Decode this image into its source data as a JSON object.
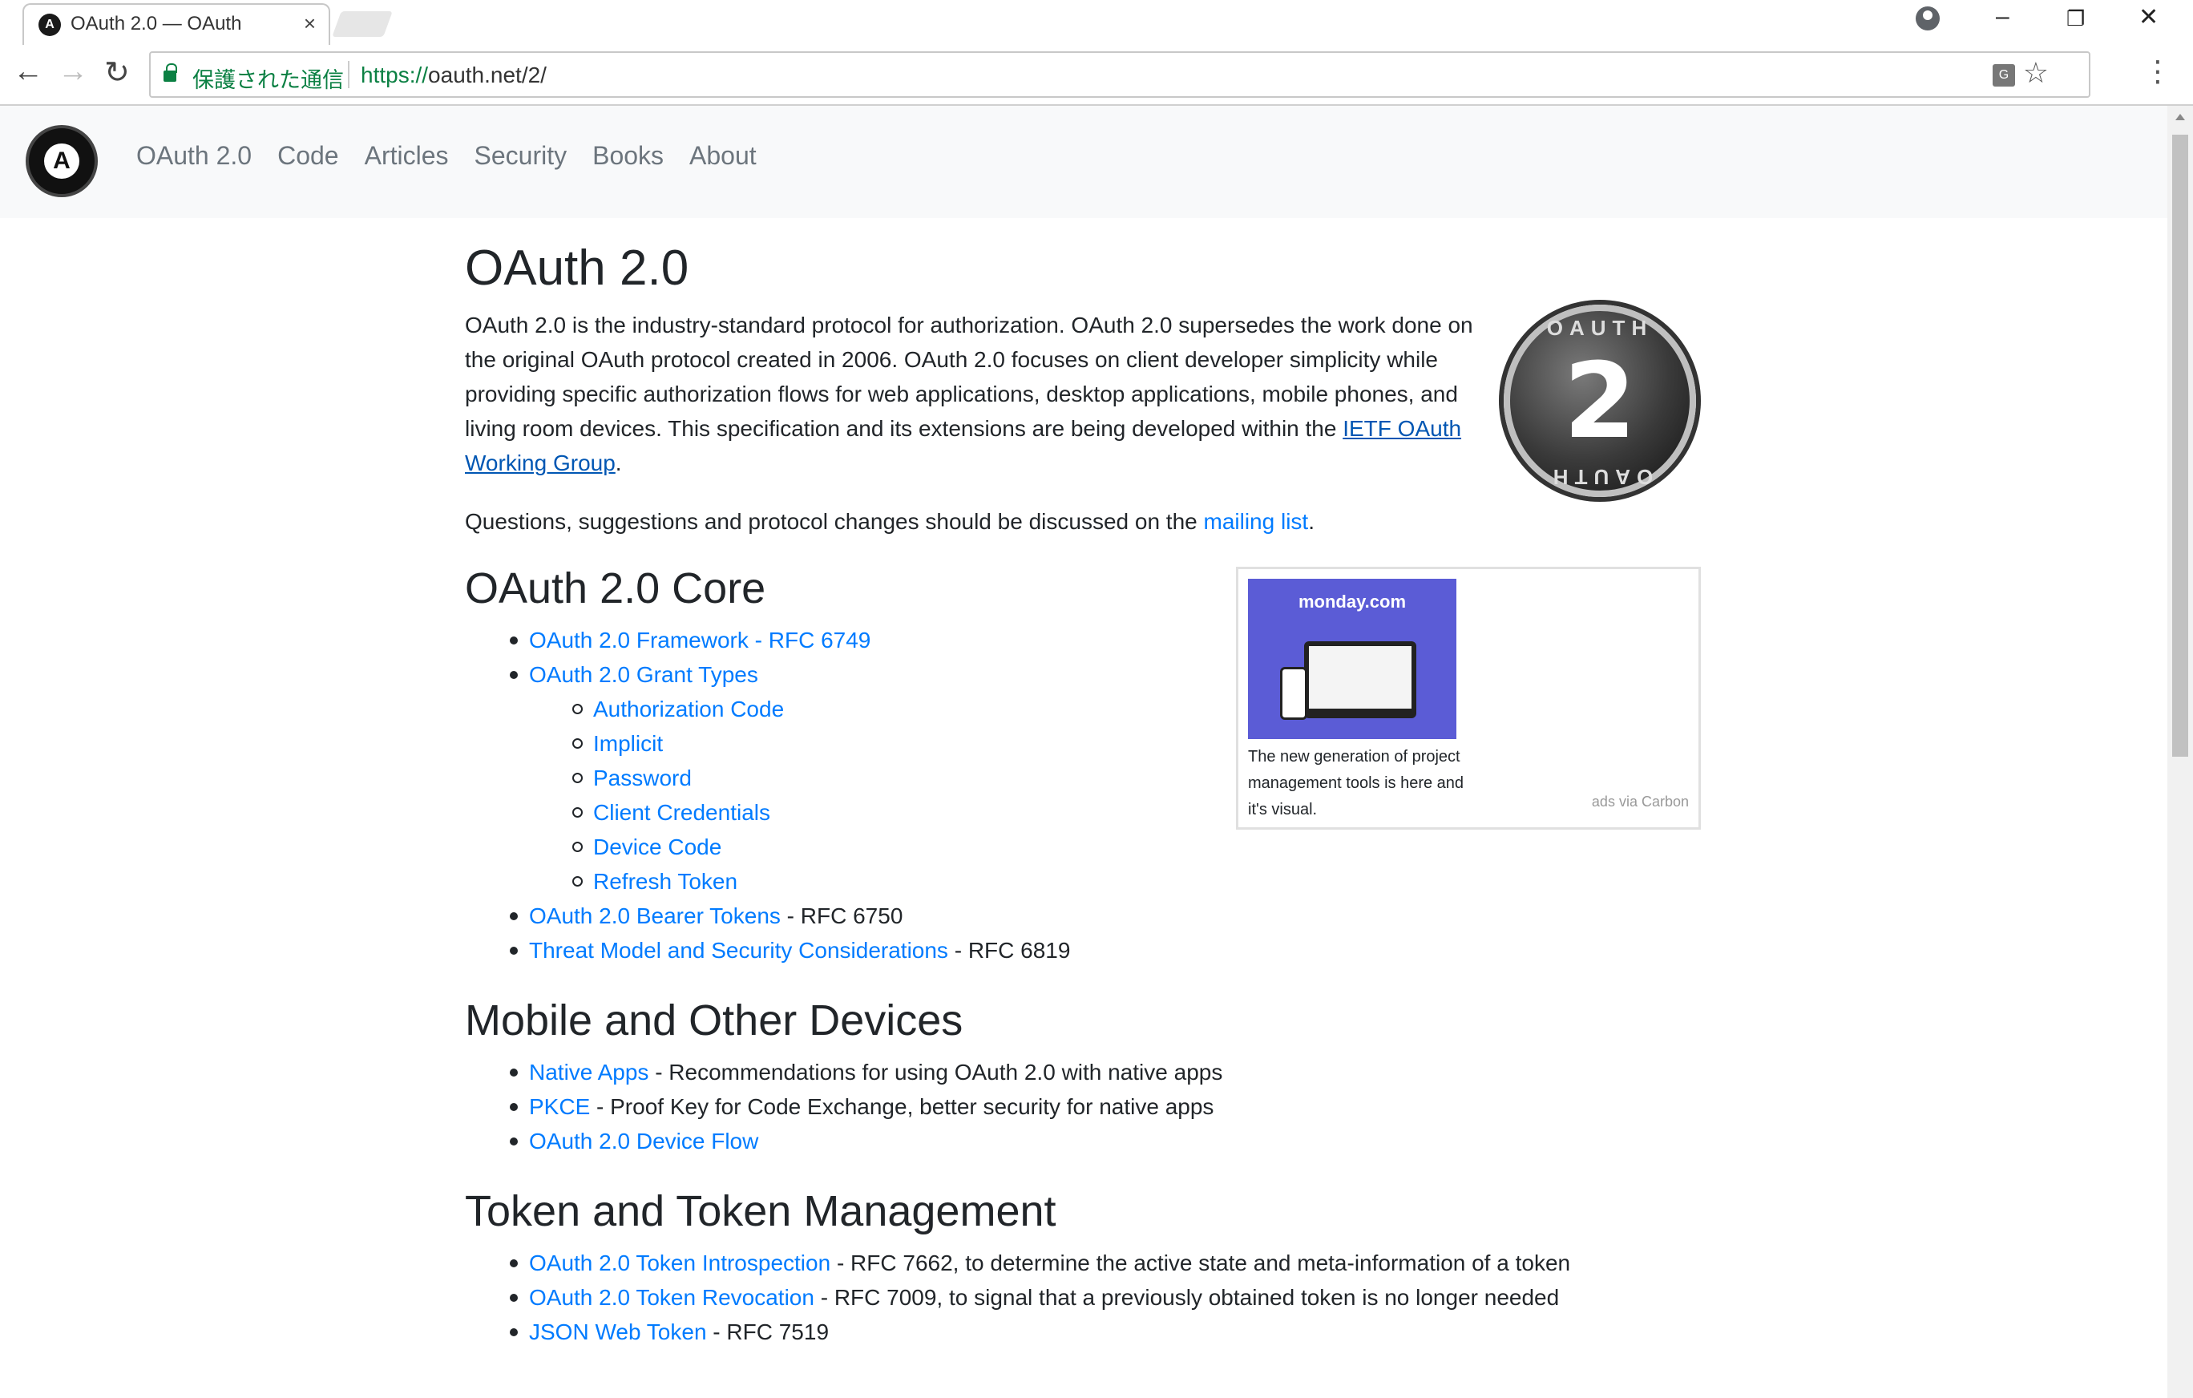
{
  "browser": {
    "tab_title": "OAuth 2.0 — OAuth",
    "tab_close": "×",
    "favicon_letter": "A",
    "secure_label": "保護された通信",
    "url_protocol": "https://",
    "url_rest": "oauth.net/2/",
    "back": "←",
    "forward": "→",
    "reload": "↻",
    "star": "☆",
    "menu": "⋮",
    "translate": "G",
    "minimize": "–",
    "restore": "❐",
    "close": "✕"
  },
  "site_nav": {
    "logo_letter": "A",
    "links": [
      "OAuth 2.0",
      "Code",
      "Articles",
      "Security",
      "Books",
      "About"
    ]
  },
  "badge": {
    "number": "2",
    "word": "OAUTH"
  },
  "page": {
    "title": "OAuth 2.0",
    "intro_text": "OAuth 2.0 is the industry-standard protocol for authorization. OAuth 2.0 supersedes the work done on the original OAuth protocol created in 2006. OAuth 2.0 focuses on client developer simplicity while providing specific authorization flows for web applications, desktop applications, mobile phones, and living room devices. This specification and its extensions are being developed within the ",
    "intro_link": "IETF OAuth Working Group",
    "intro_end": ".",
    "questions_text": "Questions, suggestions and protocol changes should be discussed on the ",
    "questions_link": "mailing list",
    "questions_end": "."
  },
  "sections": {
    "core": {
      "title": "OAuth 2.0 Core",
      "framework": "OAuth 2.0 Framework - RFC 6749",
      "grant_types": "OAuth 2.0 Grant Types",
      "grants": [
        "Authorization Code",
        "Implicit",
        "Password",
        "Client Credentials",
        "Device Code",
        "Refresh Token"
      ],
      "bearer_link": "OAuth 2.0 Bearer Tokens",
      "bearer_rest": " - RFC 6750",
      "threat_link": "Threat Model and Security Considerations",
      "threat_rest": " - RFC 6819"
    },
    "mobile": {
      "title": "Mobile and Other Devices",
      "native_link": "Native Apps",
      "native_rest": " - Recommendations for using OAuth 2.0 with native apps",
      "pkce_link": "PKCE",
      "pkce_rest": " - Proof Key for Code Exchange, better security for native apps",
      "device_link": "OAuth 2.0 Device Flow"
    },
    "token": {
      "title": "Token and Token Management",
      "introspection_link": "OAuth 2.0 Token Introspection",
      "introspection_rest": " - RFC 7662, to determine the active state and meta-information of a token",
      "revocation_link": "OAuth 2.0 Token Revocation",
      "revocation_rest": " - RFC 7009, to signal that a previously obtained token is no longer needed",
      "jwt_link": "JSON Web Token",
      "jwt_rest": " - RFC 7519"
    }
  },
  "ad": {
    "brand": "monday.com",
    "caption": "The new generation of project management tools is here and it's visual.",
    "via": "ads via Carbon"
  },
  "colors": {
    "link": "#007bff",
    "secure": "#0b8043",
    "ad_bg": "#5b5cd6"
  }
}
